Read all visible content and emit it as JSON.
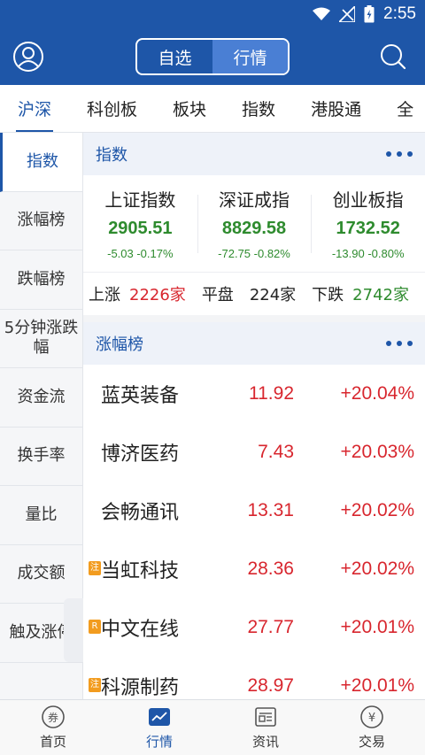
{
  "status": {
    "time": "2:55"
  },
  "header": {
    "segments": [
      {
        "label": "自选",
        "active": false
      },
      {
        "label": "行情",
        "active": true
      }
    ]
  },
  "top_tabs": [
    "沪深",
    "科创板",
    "板块",
    "指数",
    "港股通",
    "全"
  ],
  "side_menu": [
    "指数",
    "涨幅榜",
    "跌幅榜",
    "5分钟涨跌幅",
    "资金流",
    "换手率",
    "量比",
    "成交额",
    "触及涨停"
  ],
  "index_section": {
    "title": "指数",
    "indices": [
      {
        "name": "上证指数",
        "value": "2905.51",
        "change": "-5.03 -0.17%"
      },
      {
        "name": "深证成指",
        "value": "8829.58",
        "change": "-72.75 -0.82%"
      },
      {
        "name": "创业板指",
        "value": "1732.52",
        "change": "-13.90 -0.80%"
      }
    ],
    "breadth": {
      "up_label": "上涨",
      "up_value": "2226家",
      "flat_label": "平盘",
      "flat_value": "224家",
      "down_label": "下跌",
      "down_value": "2742家"
    }
  },
  "gainers_section": {
    "title": "涨幅榜",
    "stocks": [
      {
        "badge": "",
        "name": "蓝英装备",
        "price": "11.92",
        "pct": "+20.04%"
      },
      {
        "badge": "",
        "name": "博济医药",
        "price": "7.43",
        "pct": "+20.03%"
      },
      {
        "badge": "",
        "name": "会畅通讯",
        "price": "13.31",
        "pct": "+20.02%"
      },
      {
        "badge": "注",
        "name": "当虹科技",
        "price": "28.36",
        "pct": "+20.02%"
      },
      {
        "badge": "R",
        "name": "中文在线",
        "price": "27.77",
        "pct": "+20.01%"
      },
      {
        "badge": "注",
        "name": "科源制药",
        "price": "28.97",
        "pct": "+20.01%"
      }
    ]
  },
  "bottom_nav": [
    {
      "label": "首页",
      "icon": "coupon-icon"
    },
    {
      "label": "行情",
      "icon": "chart-icon"
    },
    {
      "label": "资讯",
      "icon": "news-icon"
    },
    {
      "label": "交易",
      "icon": "yuan-icon"
    }
  ],
  "colors": {
    "brand": "#1e56a8",
    "rise": "#d8262e",
    "fall": "#2e8b2e"
  }
}
